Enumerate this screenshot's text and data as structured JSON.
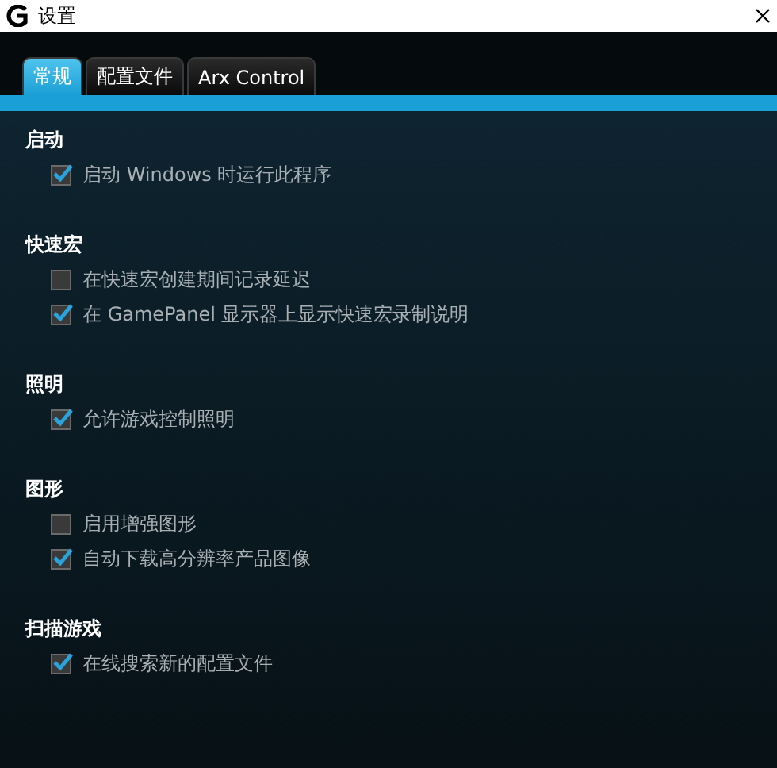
{
  "window": {
    "title": "设置"
  },
  "tabs": [
    {
      "label": "常规",
      "selected": true
    },
    {
      "label": "配置文件",
      "selected": false
    },
    {
      "label": "Arx Control",
      "selected": false
    }
  ],
  "sections": [
    {
      "title": "启动",
      "options": [
        {
          "label": "启动 Windows 时运行此程序",
          "checked": true
        }
      ]
    },
    {
      "title": "快速宏",
      "options": [
        {
          "label": "在快速宏创建期间记录延迟",
          "checked": false
        },
        {
          "label": "在 GamePanel 显示器上显示快速宏录制说明",
          "checked": true
        }
      ]
    },
    {
      "title": "照明",
      "options": [
        {
          "label": "允许游戏控制照明",
          "checked": true
        }
      ]
    },
    {
      "title": "图形",
      "options": [
        {
          "label": "启用增强图形",
          "checked": false
        },
        {
          "label": "自动下载高分辨率产品图像",
          "checked": true
        }
      ]
    },
    {
      "title": "扫描游戏",
      "options": [
        {
          "label": "在线搜索新的配置文件",
          "checked": true
        }
      ]
    }
  ]
}
